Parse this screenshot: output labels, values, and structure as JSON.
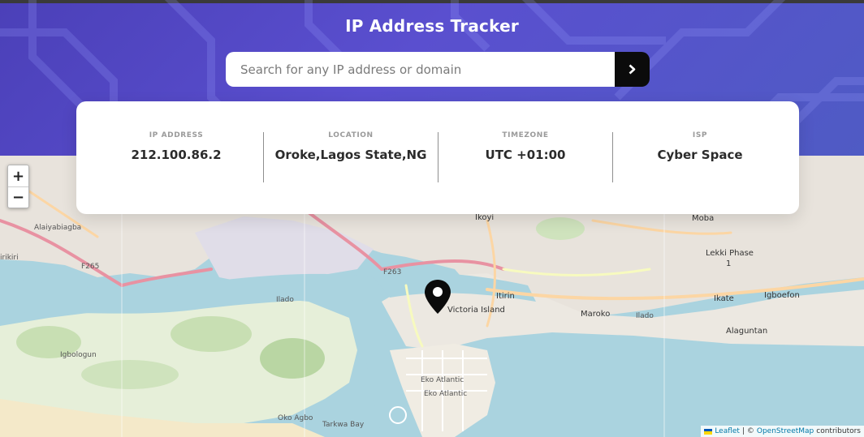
{
  "header": {
    "title": "IP Address Tracker",
    "search": {
      "placeholder": "Search for any IP address or domain",
      "value": ""
    },
    "submit_icon": "chevron-right-icon"
  },
  "info": [
    {
      "label": "IP ADDRESS",
      "value": "212.100.86.2"
    },
    {
      "label": "LOCATION",
      "value": "Oroke,Lagos State,NG"
    },
    {
      "label": "TIMEZONE",
      "value": "UTC +01:00"
    },
    {
      "label": "ISP",
      "value": "Cyber Space"
    }
  ],
  "map": {
    "zoom_in": "+",
    "zoom_out": "−",
    "marker_icon": "location-pin-icon",
    "labels": {
      "alaiyabiagba": "Alaiyabiagba",
      "irikiri": "irikiri",
      "f265": "F265",
      "ilado": "Ilado",
      "igbologun": "Igbologun",
      "oko_agbo": "Oko Agbo",
      "tarkwa_bay": "Tarkwa Bay",
      "ikoyi": "Ikoyi",
      "itirin": "Itirin",
      "victoria_island": "Victoria Island",
      "maroko": "Maroko",
      "ilado_east": "Ilado",
      "eko_atlantic_1": "Eko Atlantic",
      "eko_atlantic_2": "Eko Atlantic",
      "moba": "Moba",
      "lekki_phase": "Lekki Phase",
      "lekki_phase_num": "1",
      "igboefon": "Igboefon",
      "ikate": "Ikate",
      "alaguntan": "Alaguntan",
      "f263": "F263"
    },
    "attribution": {
      "leaflet": "Leaflet",
      "separator": "| ©",
      "osm": "OpenStreetMap",
      "suffix": "contributors"
    }
  },
  "colors": {
    "header_gradient_start": "#4b40b8",
    "header_gradient_end": "#4f5bc4",
    "search_button": "#0b0b0b",
    "water": "#aad3df",
    "land": "#f2efe9",
    "marker": "#0b0b0b"
  }
}
